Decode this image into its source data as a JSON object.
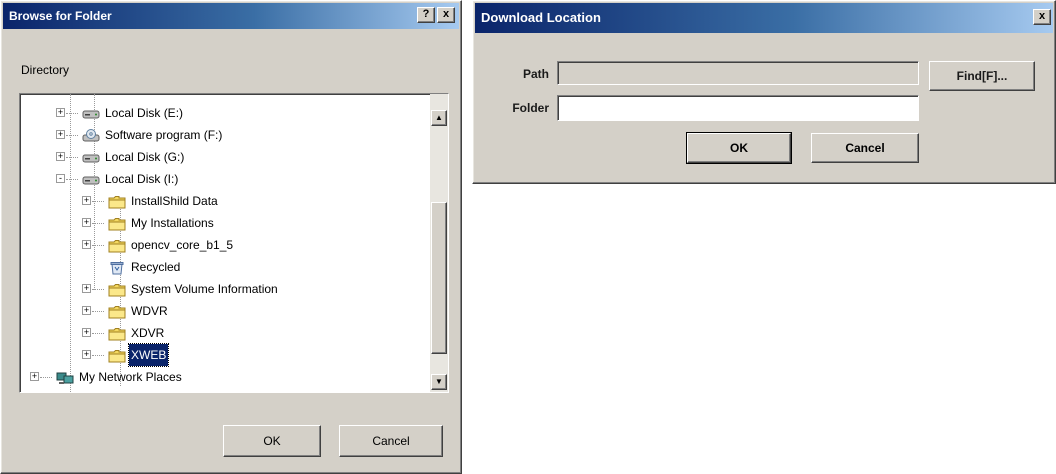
{
  "browse_dialog": {
    "title": "Browse for Folder",
    "help_button": "?",
    "close_button": "x",
    "directory_label": "Directory",
    "tree": [
      {
        "label": "Local Disk (E:)",
        "icon": "drive-icon",
        "expander": "+"
      },
      {
        "label": "Software program (F:)",
        "icon": "cd-drive-icon",
        "expander": "+"
      },
      {
        "label": "Local Disk (G:)",
        "icon": "drive-icon",
        "expander": "+"
      },
      {
        "label": "Local Disk (I:)",
        "icon": "drive-icon",
        "expander": "-"
      },
      {
        "label": "InstallShild Data",
        "icon": "folder-icon",
        "expander": "+"
      },
      {
        "label": "My Installations",
        "icon": "folder-icon",
        "expander": "+"
      },
      {
        "label": "opencv_core_b1_5",
        "icon": "folder-icon",
        "expander": "+"
      },
      {
        "label": "Recycled",
        "icon": "recycle-bin-icon",
        "expander": ""
      },
      {
        "label": "System Volume Information",
        "icon": "folder-icon",
        "expander": "+"
      },
      {
        "label": "WDVR",
        "icon": "folder-icon",
        "expander": "+"
      },
      {
        "label": "XDVR",
        "icon": "folder-icon",
        "expander": "+"
      },
      {
        "label": "XWEB",
        "icon": "folder-icon",
        "expander": "+",
        "selected": true
      },
      {
        "label": "My Network Places",
        "icon": "network-icon",
        "expander": "+"
      }
    ],
    "ok_label": "OK",
    "cancel_label": "Cancel"
  },
  "download_dialog": {
    "title": "Download Location",
    "close_button": "x",
    "path_label": "Path",
    "path_value": "",
    "folder_label": "Folder",
    "folder_value": "",
    "find_label": "Find[F]...",
    "ok_label": "OK",
    "cancel_label": "Cancel"
  },
  "colors": {
    "title_start": "#0a246a",
    "title_end": "#a6caf0",
    "face": "#d4d0c8",
    "selection": "#0a246a"
  }
}
